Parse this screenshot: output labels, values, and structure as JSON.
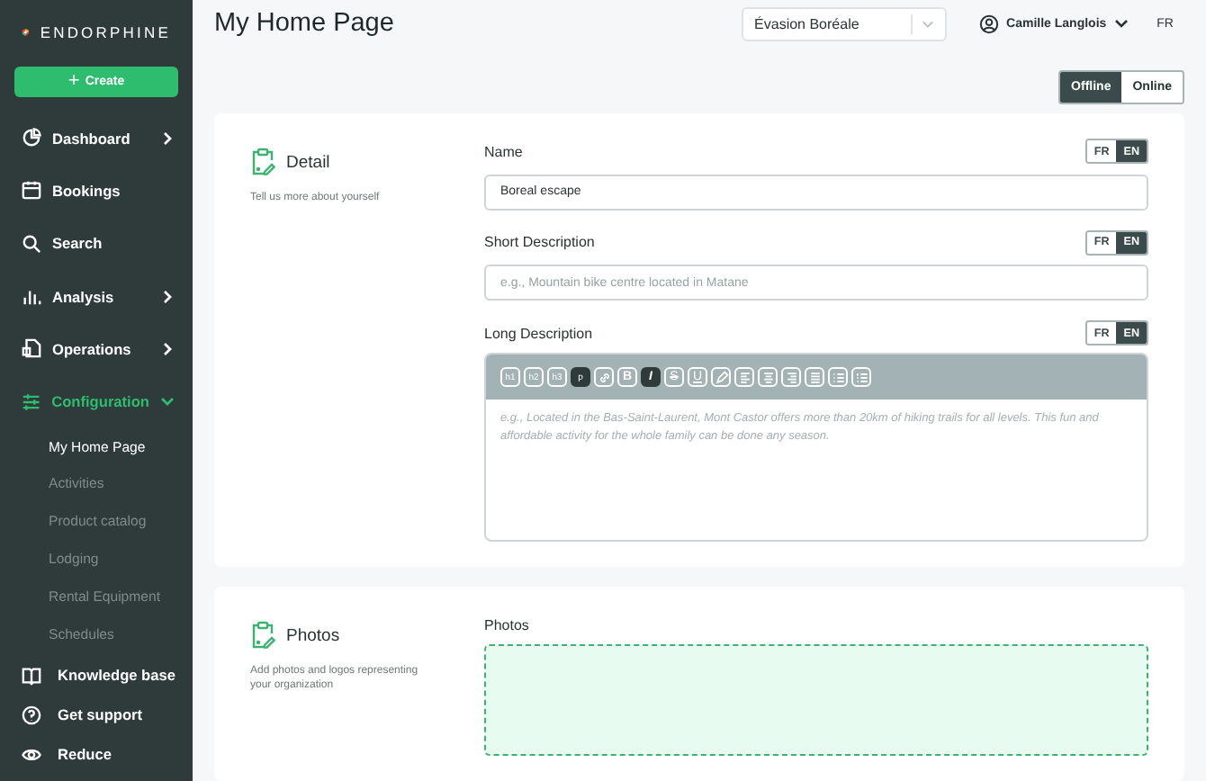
{
  "sidebar": {
    "brand": "ENDORPHINE",
    "create_button": {
      "label": "Create",
      "icon": "+"
    },
    "items": [
      {
        "label": "Dashboard",
        "kind": "group",
        "expanded": false,
        "selected": false
      },
      {
        "label": "Bookings",
        "kind": "link",
        "selected": false
      },
      {
        "label": "Search",
        "kind": "link",
        "selected": false
      },
      {
        "label": "Analysis",
        "kind": "group",
        "expanded": false,
        "selected": false
      },
      {
        "label": "Operations",
        "kind": "group",
        "expanded": false,
        "selected": false
      },
      {
        "label": "Configuration",
        "kind": "group",
        "expanded": true,
        "selected": true
      }
    ],
    "subitems": [
      {
        "label": "My Home Page",
        "selected": true
      },
      {
        "label": "Activities",
        "selected": false
      },
      {
        "label": "Product catalog",
        "selected": false
      },
      {
        "label": "Lodging",
        "selected": false
      },
      {
        "label": "Rental Equipment",
        "selected": false
      },
      {
        "label": "Schedules",
        "selected": false
      }
    ],
    "footer_items": [
      {
        "label": "Knowledge base"
      },
      {
        "label": "Get support"
      },
      {
        "label": "Reduce"
      }
    ]
  },
  "header": {
    "title": "My Home Page",
    "organization_select": {
      "value": "Évasion Boréale"
    },
    "user": "Camille Langlois",
    "language": "FR"
  },
  "mode_toggle": [
    {
      "label": "Offline",
      "selected": true
    },
    {
      "label": "Online",
      "selected": false
    }
  ],
  "sections": [
    {
      "title": "Detail",
      "subtitle": "Tell us more about yourself",
      "fields": [
        {
          "kind": "input",
          "label": "Name",
          "value": "Boreal escape",
          "languages": [
            {
              "label": "FR",
              "selected": false
            },
            {
              "label": "EN",
              "selected": true
            }
          ]
        },
        {
          "kind": "input",
          "label": "Short Description",
          "placeholder": "e.g., Mountain bike centre located in Matane",
          "languages": [
            {
              "label": "FR",
              "selected": false
            },
            {
              "label": "EN",
              "selected": true
            }
          ]
        },
        {
          "kind": "editor",
          "label": "Long Description",
          "placeholder": "e.g., Located in the Bas-Saint-Laurent, Mont Castor offers more than 20km of hiking trails for all levels. This fun and affordable activity for the whole family can be done any season.",
          "languages": [
            {
              "label": "FR",
              "selected": false
            },
            {
              "label": "EN",
              "selected": true
            }
          ],
          "toolbar": [
            {
              "kind": "text",
              "label": "h1",
              "selected": false
            },
            {
              "kind": "text",
              "label": "h2",
              "selected": false
            },
            {
              "kind": "text",
              "label": "h3",
              "selected": false
            },
            {
              "kind": "text",
              "label": "p",
              "selected": true
            },
            {
              "kind": "link",
              "selected": false
            },
            {
              "kind": "bold",
              "label": "B",
              "selected": false
            },
            {
              "kind": "italic",
              "label": "I",
              "selected": true
            },
            {
              "kind": "strike",
              "label": "S",
              "selected": false
            },
            {
              "kind": "underline",
              "label": "U",
              "selected": false
            },
            {
              "kind": "pen",
              "selected": false
            },
            {
              "kind": "align-left",
              "selected": false
            },
            {
              "kind": "align-center",
              "selected": false
            },
            {
              "kind": "align-right",
              "selected": false
            },
            {
              "kind": "justify",
              "selected": false
            },
            {
              "kind": "bullets",
              "selected": false
            },
            {
              "kind": "numbers",
              "selected": false
            }
          ]
        }
      ]
    },
    {
      "title": "Photos",
      "subtitle": "Add photos and logos representing your organization",
      "fields": [
        {
          "kind": "dropzone",
          "label": "Photos"
        }
      ]
    }
  ]
}
